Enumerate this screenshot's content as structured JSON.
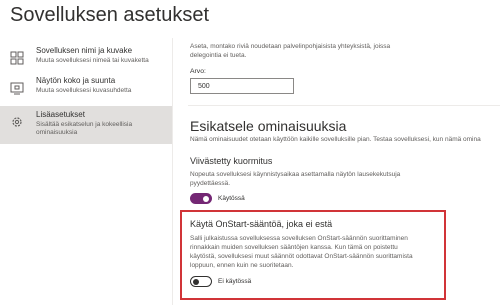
{
  "window": {
    "title": "Sovelluksen asetukset"
  },
  "sidebar": {
    "items": [
      {
        "label": "Sovelluksen nimi ja kuvake",
        "sublabel": "Muuta sovelluksesi nimeä tai kuvaketta",
        "icon": "app-tile-icon"
      },
      {
        "label": "Näytön koko ja suunta",
        "sublabel": "Muuta sovelluksesi kuvasuhdetta",
        "icon": "screen-size-icon"
      },
      {
        "label": "Lisäasetukset",
        "sublabel_lines": [
          "Sisältää esikatselun ja kokeellisia",
          "ominaisuuksia"
        ],
        "icon": "gear-icon",
        "selected": true
      }
    ]
  },
  "main": {
    "row_limit": {
      "description_lines": [
        "Aseta, montako riviä noudetaan palvelinpohjaisista yhteyksistä, joissa",
        "delegointia ei tueta."
      ],
      "label": "Arvo:",
      "value": "500"
    },
    "preview": {
      "heading": "Esikatsele ominaisuuksia",
      "description": "Nämä ominaisuudet otetaan käyttöön kaikille sovelluksille pian. Testaa sovelluksesi, kun nämä omina"
    },
    "delayed_load": {
      "title": "Viivästetty kuormitus",
      "description_lines": [
        "Nopeuta sovelluksesi käynnistysaikaa asettamalla näytön lausekekutsuja",
        "pyydettäessä."
      ],
      "toggle_label": "Käytössä",
      "enabled": true
    },
    "onstart": {
      "title": "Käytä OnStart-sääntöä, joka ei estä",
      "description_lines": [
        "Salli julkaistussa sovelluksessa sovelluksen OnStart-säännön suorittaminen",
        "rinnakkain muiden sovelluksen sääntöjen kanssa. Kun tämä on poistettu",
        "käytöstä, sovelluksesi muut säännöt odottavat OnStart-säännön suorittamista",
        "loppuun, ennen kuin ne suoritetaan."
      ],
      "toggle_label": "Ei käytössä",
      "enabled": false
    }
  },
  "colors": {
    "accent": "#742774",
    "highlight_border": "#d13438",
    "selected_bg": "#e1dfdd"
  }
}
